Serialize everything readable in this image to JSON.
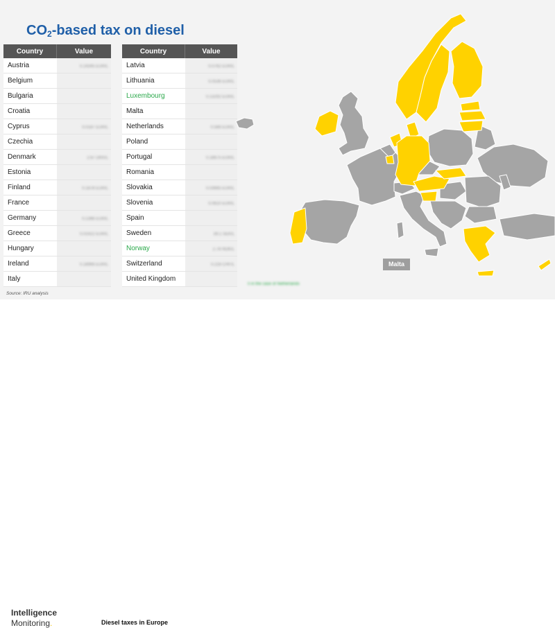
{
  "title": {
    "prefix": "CO",
    "sub": "2",
    "suffix": "-based tax on diesel"
  },
  "columns": {
    "country": "Country",
    "value": "Value"
  },
  "left_rows": [
    {
      "country": "Austria",
      "value": "0.14345 EUR/L",
      "highlight": false
    },
    {
      "country": "Belgium",
      "value": "",
      "highlight": false
    },
    {
      "country": "Bulgaria",
      "value": "",
      "highlight": false
    },
    {
      "country": "Croatia",
      "value": "",
      "highlight": false
    },
    {
      "country": "Cyprus",
      "value": "0.0187 EUR/L",
      "highlight": false
    },
    {
      "country": "Czechia",
      "value": "",
      "highlight": false
    },
    {
      "country": "Denmark",
      "value": "2.67 DKK/L",
      "highlight": false
    },
    {
      "country": "Estonia",
      "value": "",
      "highlight": false
    },
    {
      "country": "Finland",
      "value": "0.1878 EUR/L",
      "highlight": false
    },
    {
      "country": "France",
      "value": "",
      "highlight": false
    },
    {
      "country": "Germany",
      "value": "0.1366 EUR/L",
      "highlight": false
    },
    {
      "country": "Greece",
      "value": "0.01422 EUR/L",
      "highlight": false
    },
    {
      "country": "Hungary",
      "value": "",
      "highlight": false
    },
    {
      "country": "Ireland",
      "value": "0.18966 EUR/L",
      "highlight": false
    },
    {
      "country": "Italy",
      "value": "",
      "highlight": false
    }
  ],
  "right_rows": [
    {
      "country": "Latvia",
      "value": "0.0762 EUR/L",
      "highlight": false
    },
    {
      "country": "Lithuania",
      "value": "0.0536 EUR/L",
      "highlight": false
    },
    {
      "country": "Luxembourg",
      "value": "0.13292 EUR/L",
      "highlight": true
    },
    {
      "country": "Malta",
      "value": "",
      "highlight": false
    },
    {
      "country": "Netherlands",
      "value": "0.566 EUR/L",
      "highlight": false
    },
    {
      "country": "Poland",
      "value": "",
      "highlight": false
    },
    {
      "country": "Portugal",
      "value": "0.18675 EUR/L",
      "highlight": false
    },
    {
      "country": "Romania",
      "value": "",
      "highlight": false
    },
    {
      "country": "Slovakia",
      "value": "0.03665 EUR/L",
      "highlight": false
    },
    {
      "country": "Slovenia",
      "value": "0.0610 EUR/L",
      "highlight": false
    },
    {
      "country": "Spain",
      "value": "",
      "highlight": false
    },
    {
      "country": "Sweden",
      "value": "39.1 SEK/L",
      "highlight": false
    },
    {
      "country": "Norway",
      "value": "2.78 NOK/L",
      "highlight": true
    },
    {
      "country": "Switzerland",
      "value": "0.216 CHF/L",
      "highlight": false
    },
    {
      "country": "United Kingdom",
      "value": "",
      "highlight": false
    }
  ],
  "source": "Source: IRU analysis",
  "map": {
    "malta_label": "Malta",
    "note": "0 in the case of Netherlands",
    "colors": {
      "taxed": "#ffd200",
      "not_taxed": "#a5a5a5",
      "border": "#ffffff"
    },
    "taxed_countries": [
      "Norway",
      "Sweden",
      "Finland",
      "Estonia",
      "Latvia",
      "Lithuania",
      "Denmark",
      "Ireland",
      "Netherlands",
      "Luxembourg",
      "Germany",
      "Austria",
      "Slovenia",
      "Slovakia",
      "Portugal",
      "Greece",
      "Cyprus"
    ]
  },
  "footer": {
    "logo_line1": "Intelligence",
    "logo_line2": "Monitoring",
    "logo_dot": ".",
    "title": "Diesel taxes in Europe"
  }
}
